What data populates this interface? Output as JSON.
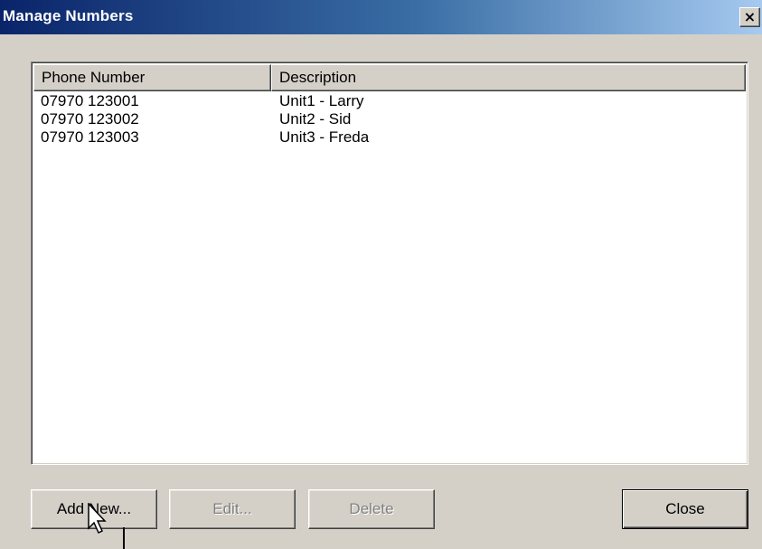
{
  "window": {
    "title": "Manage Numbers",
    "close_glyph": "×"
  },
  "list": {
    "columns": [
      "Phone Number",
      "Description"
    ],
    "rows": [
      {
        "phone": "07970 123001",
        "description": "Unit1 - Larry"
      },
      {
        "phone": "07970 123002",
        "description": "Unit2 - Sid"
      },
      {
        "phone": "07970 123003",
        "description": "Unit3 - Freda"
      }
    ]
  },
  "buttons": {
    "add_new": "Add New...",
    "edit": "Edit...",
    "delete": "Delete",
    "close": "Close"
  },
  "colors": {
    "face": "#d4d0c8",
    "title_start": "#0a246a",
    "title_end": "#a6caf0",
    "disabled_text": "#808080"
  },
  "icons": {
    "close": "close-icon",
    "cursor": "arrow-cursor-icon",
    "text_cursor": "text-cursor-icon"
  }
}
